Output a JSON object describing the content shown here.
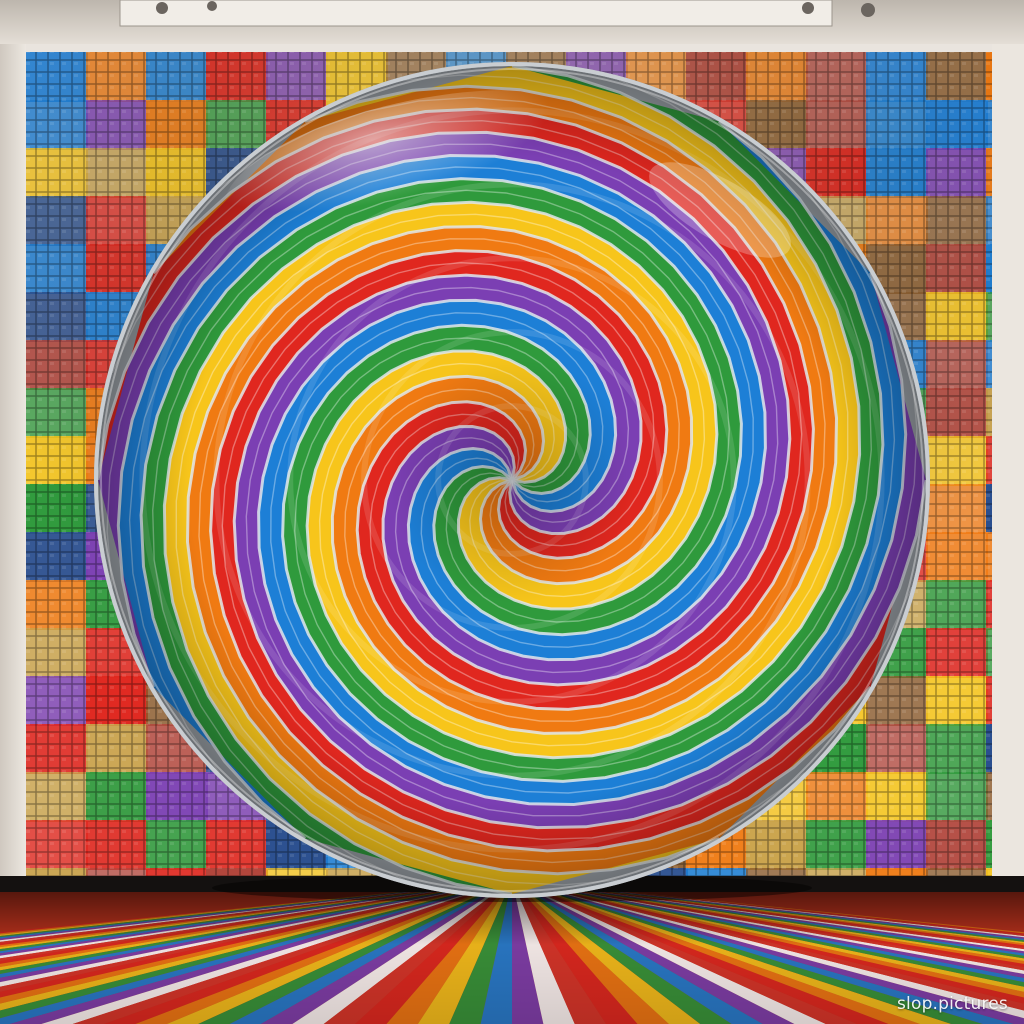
{
  "watermark": "slop.pictures",
  "palette": {
    "red": "#e0271f",
    "orange": "#f07a12",
    "yellow": "#f7c51b",
    "green": "#2f9a3c",
    "blue": "#1d7fd6",
    "purple": "#7b3fb3"
  }
}
